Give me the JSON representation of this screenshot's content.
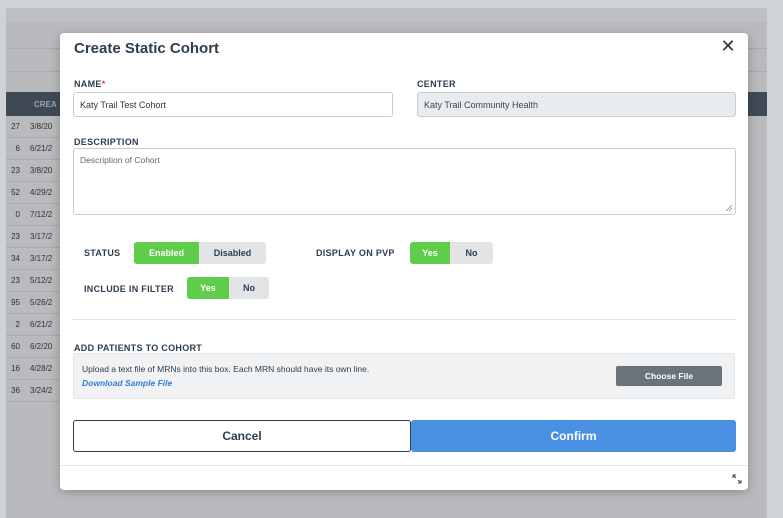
{
  "background": {
    "table_header_label": "CREA",
    "rows": [
      {
        "a": "27",
        "b": "3/8/20"
      },
      {
        "a": "6",
        "b": "6/21/2"
      },
      {
        "a": "23",
        "b": "3/8/20"
      },
      {
        "a": "52",
        "b": "4/29/2"
      },
      {
        "a": "0",
        "b": "7/12/2"
      },
      {
        "a": "23",
        "b": "3/17/2"
      },
      {
        "a": "34",
        "b": "3/17/2"
      },
      {
        "a": "23",
        "b": "5/12/2"
      },
      {
        "a": "95",
        "b": "5/26/2"
      },
      {
        "a": "2",
        "b": "6/21/2"
      },
      {
        "a": "60",
        "b": "6/2/20"
      },
      {
        "a": "16",
        "b": "4/28/2"
      },
      {
        "a": "36",
        "b": "3/24/2"
      }
    ]
  },
  "modal": {
    "title": "Create Static Cohort",
    "close_glyph": "✕",
    "name": {
      "label": "NAME",
      "required_mark": "*",
      "value": "Katy Trail Test Cohort"
    },
    "center": {
      "label": "CENTER",
      "value": "Katy Trail Community Health"
    },
    "description": {
      "label": "DESCRIPTION",
      "placeholder": "Description of Cohort"
    },
    "status": {
      "label": "STATUS",
      "options": [
        "Enabled",
        "Disabled"
      ],
      "selected": "Enabled"
    },
    "display_on_pvp": {
      "label": "DISPLAY ON PVP",
      "options": [
        "Yes",
        "No"
      ],
      "selected": "Yes"
    },
    "include_in_filter": {
      "label": "INCLUDE IN FILTER",
      "options": [
        "Yes",
        "No"
      ],
      "selected": "Yes"
    },
    "add_patients": {
      "label": "ADD PATIENTS TO COHORT",
      "instructions": "Upload a text file of MRNs into this box. Each MRN should have its own line.",
      "sample_link": "Download Sample File",
      "choose_file_label": "Choose File"
    },
    "cancel_label": "Cancel",
    "confirm_label": "Confirm"
  },
  "colors": {
    "accent_green": "#5fcd4a",
    "primary_blue": "#4a90e2",
    "link_blue": "#2d7fd3"
  }
}
